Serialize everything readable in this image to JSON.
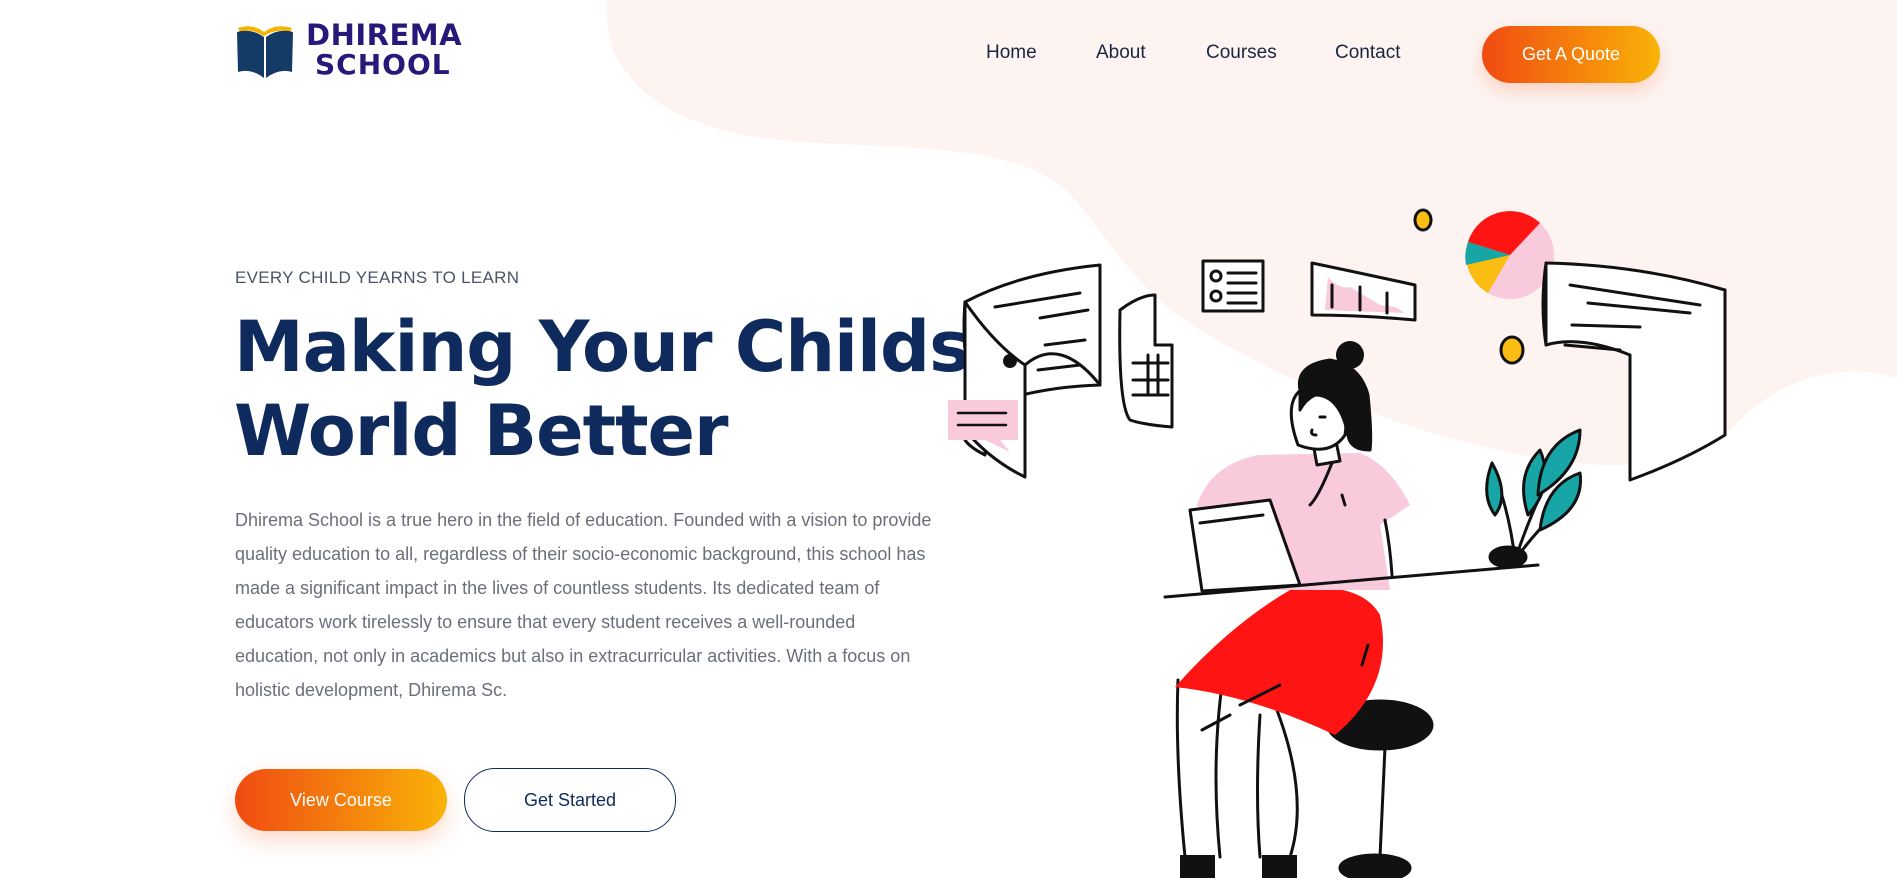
{
  "brand": {
    "name_line1": "DHIREMA",
    "name_line2": "SCHOOL",
    "colors": {
      "navy": "#0f2a5c",
      "accent_start": "#f04b12",
      "accent_end": "#f9b307",
      "blob": "#fdf4f2"
    }
  },
  "nav": {
    "items": [
      {
        "label": "Home"
      },
      {
        "label": "About"
      },
      {
        "label": "Courses"
      },
      {
        "label": "Contact"
      }
    ],
    "cta_label": "Get A Quote"
  },
  "hero": {
    "eyebrow": "EVERY CHILD YEARNS TO LEARN",
    "title_line1": "Making Your Childs",
    "title_line2": "World Better",
    "description": "Dhirema School is a true hero in the field of education. Founded with a vision to provide quality education to all, regardless of their socio-economic background, this school has made a significant impact in the lives of countless students. Its dedicated team of educators work tirelessly to ensure that every student receives a well-rounded education, not only in academics but also in extracurricular activities. With a focus on holistic development, Dhirema Sc.",
    "primary_button": "View Course",
    "secondary_button": "Get Started"
  },
  "illustration": {
    "icon": "woman-working-on-laptop-illustration"
  }
}
